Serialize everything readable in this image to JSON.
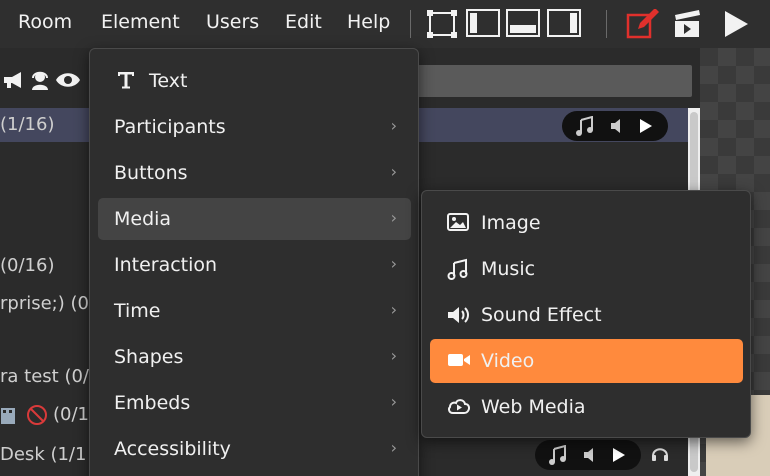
{
  "menubar": {
    "items": [
      {
        "label": "Room"
      },
      {
        "label": "Element"
      },
      {
        "label": "Users"
      },
      {
        "label": "Edit"
      },
      {
        "label": "Help"
      }
    ],
    "toolbar_icons": [
      "select-frame-icon",
      "layout-left-icon",
      "layout-bottom-icon",
      "layout-right-icon",
      "edit-note-icon",
      "clapperboard-icon",
      "play-icon"
    ],
    "accent_edit_color": "#e0302c"
  },
  "background": {
    "rows": [
      {
        "text": "(1/16)"
      },
      {
        "text": "(0/16)"
      },
      {
        "text": "rprise;) (0"
      },
      {
        "text": "ra test (0/"
      },
      {
        "text": "(0/1"
      },
      {
        "text": "Desk (1/1"
      }
    ]
  },
  "element_menu": {
    "items": [
      {
        "label": "Text",
        "icon": "text-icon"
      },
      {
        "label": "Participants",
        "arrow": "›"
      },
      {
        "label": "Buttons",
        "arrow": "›"
      },
      {
        "label": "Media",
        "arrow": "›"
      },
      {
        "label": "Interaction",
        "arrow": "›"
      },
      {
        "label": "Time",
        "arrow": "›"
      },
      {
        "label": "Shapes",
        "arrow": "›"
      },
      {
        "label": "Embeds",
        "arrow": "›"
      },
      {
        "label": "Accessibility",
        "arrow": "›"
      }
    ],
    "active_item": "Media"
  },
  "media_submenu": {
    "items": [
      {
        "label": "Image",
        "icon": "image-icon"
      },
      {
        "label": "Music",
        "icon": "music-icon"
      },
      {
        "label": "Sound Effect",
        "icon": "sound-effect-icon"
      },
      {
        "label": "Video",
        "icon": "video-icon"
      },
      {
        "label": "Web Media",
        "icon": "web-media-icon"
      }
    ],
    "highlighted_item": "Video",
    "highlight_color": "#ff8a3d"
  }
}
